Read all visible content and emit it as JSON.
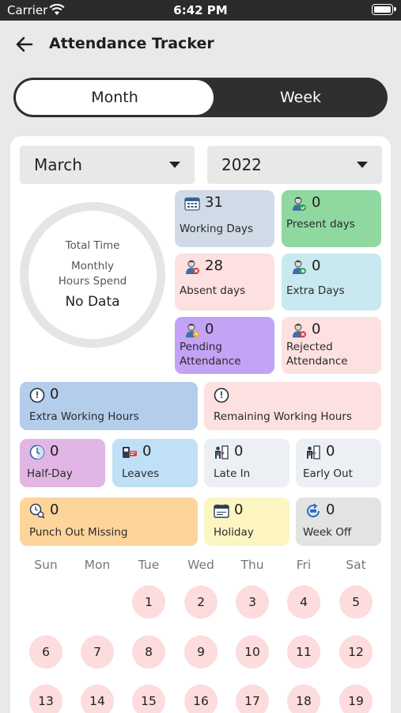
{
  "status_bar": {
    "carrier": "Carrier",
    "time": "6:42 PM"
  },
  "header": {
    "title": "Attendance Tracker"
  },
  "view_toggle": {
    "month": "Month",
    "week": "Week",
    "selected": "Month"
  },
  "filters": {
    "month": "March",
    "year": "2022"
  },
  "summary": {
    "line1": "Total Time",
    "line2a": "Monthly",
    "line2b": "Hours Spend",
    "value": "No Data"
  },
  "tiles": {
    "working_days": {
      "count": "31",
      "label": "Working Days",
      "icon": "calendar-grid-icon",
      "color": "#d0dbe7"
    },
    "present_days": {
      "count": "0",
      "label": "Present days",
      "icon": "person-check-icon",
      "color": "#8fd9a1"
    },
    "absent_days": {
      "count": "28",
      "label": "Absent days",
      "icon": "person-cross-icon",
      "color": "#fde0e0"
    },
    "extra_days": {
      "count": "0",
      "label": "Extra Days",
      "icon": "person-plus-icon",
      "color": "#c8e9ef"
    },
    "pending_attendance": {
      "count": "0",
      "label1": "Pending",
      "label2": "Attendance",
      "icon": "person-clock-icon",
      "color": "#c3a3f5"
    },
    "rejected_attendance": {
      "count": "0",
      "label1": "Rejected",
      "label2": "Attendance",
      "icon": "person-cross-icon",
      "color": "#fde0e0"
    },
    "extra_working_hours": {
      "count": "0",
      "label": "Extra Working Hours",
      "icon": "clock-icon",
      "color": "#b4cdeb"
    },
    "remaining_working_hours": {
      "count": "",
      "label": "Remaining Working Hours",
      "icon": "clock-icon",
      "color": "#fde0e0"
    },
    "half_day": {
      "count": "0",
      "label": "Half-Day",
      "icon": "half-clock-icon",
      "color": "#e1b6e4"
    },
    "leaves": {
      "count": "0",
      "label": "Leaves",
      "icon": "leave-card-icon",
      "color": "#bfe0f7"
    },
    "late_in": {
      "count": "0",
      "label": "Late In",
      "icon": "person-door-in-icon",
      "color": "#ecf0f4"
    },
    "early_out": {
      "count": "0",
      "label": "Early Out",
      "icon": "person-door-out-icon",
      "color": "#ecf0f4"
    },
    "punch_out_missing": {
      "count": "0",
      "label": "Punch Out Missing",
      "icon": "clock-search-icon",
      "color": "#fdd59b"
    },
    "holiday": {
      "count": "0",
      "label": "Holiday",
      "icon": "holiday-calendar-icon",
      "color": "#fdf6c3"
    },
    "week_off": {
      "count": "0",
      "label": "Week Off",
      "icon": "weekly-cycle-icon",
      "color": "#e3e3e3"
    }
  },
  "calendar": {
    "weekdays": [
      "Sun",
      "Mon",
      "Tue",
      "Wed",
      "Thu",
      "Fri",
      "Sat"
    ],
    "rows": [
      [
        "",
        "",
        "1",
        "2",
        "3",
        "4",
        "5"
      ],
      [
        "6",
        "7",
        "8",
        "9",
        "10",
        "11",
        "12"
      ],
      [
        "13",
        "14",
        "15",
        "16",
        "17",
        "18",
        "19"
      ]
    ],
    "day_color": "#fcdcdd"
  }
}
